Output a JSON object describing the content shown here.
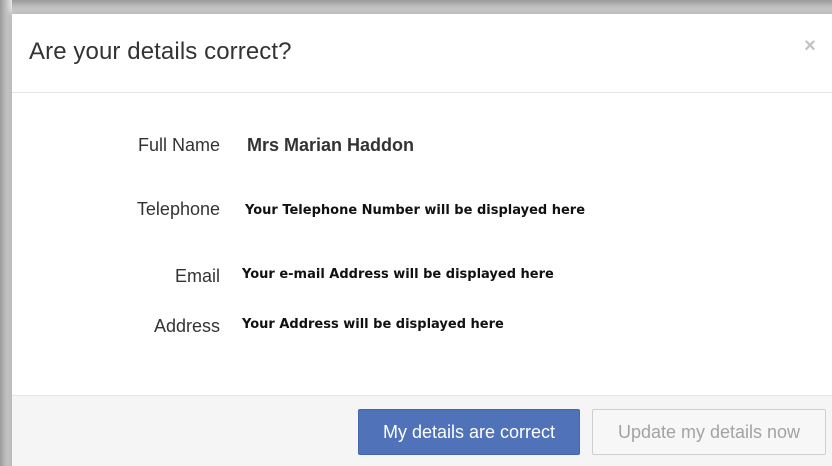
{
  "dialog": {
    "title": "Are your details correct?",
    "close_glyph": "×"
  },
  "details": {
    "full_name_label": "Full Name",
    "full_name_value": "Mrs Marian Haddon",
    "telephone_label": "Telephone",
    "telephone_value": "Your Telephone Number will be displayed here",
    "email_label": "Email",
    "email_value": "Your e-mail Address will be displayed here",
    "address_label": "Address",
    "address_value": "Your Address will be displayed here"
  },
  "footer": {
    "confirm_label": "My details are correct",
    "update_label": "Update my details now"
  },
  "colors": {
    "primary_button": "#4f72b8",
    "disabled_text": "#a3a3a3"
  }
}
